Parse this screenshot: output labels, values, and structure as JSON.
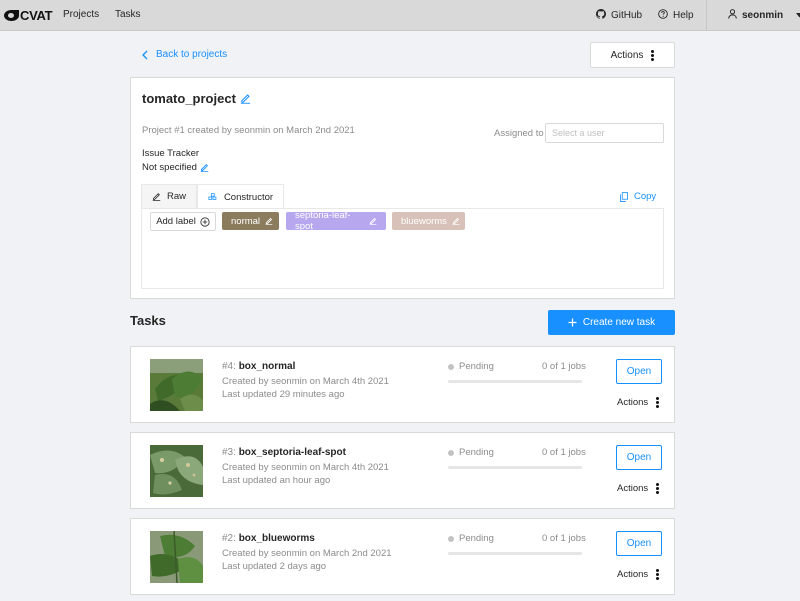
{
  "header": {
    "logo_text": "CVAT",
    "nav": [
      "Projects",
      "Tasks"
    ],
    "github_label": "GitHub",
    "help_label": "Help",
    "username": "seonmin"
  },
  "back_link": "Back to projects",
  "actions_label": "Actions",
  "project": {
    "name": "tomato_project",
    "meta": "Project #1 created by seonmin on March 2nd 2021",
    "assigned_to_label": "Assigned to",
    "assignee_placeholder": "Select a user",
    "issue_tracker_label": "Issue Tracker",
    "issue_tracker_value": "Not specified"
  },
  "label_editor": {
    "tabs": [
      "Raw",
      "Constructor"
    ],
    "active_tab": "Constructor",
    "copy_label": "Copy",
    "add_label": "Add label",
    "labels": [
      {
        "name": "normal",
        "color": "#8c7c5e"
      },
      {
        "name": "septoria-leaf-spot",
        "color": "#b6a7ee"
      },
      {
        "name": "blueworms",
        "color": "#d8c1b9"
      }
    ]
  },
  "tasks_section": {
    "title": "Tasks",
    "create_button": "Create new task"
  },
  "tasks": [
    {
      "id": "#4:",
      "name": "box_normal",
      "created": "Created by seonmin on March 4th 2021",
      "updated": "Last updated 29 minutes ago",
      "status": "Pending",
      "jobs": "0 of 1 jobs",
      "progress": 0,
      "open": "Open",
      "actions": "Actions"
    },
    {
      "id": "#3:",
      "name": "box_septoria-leaf-spot",
      "created": "Created by seonmin on March 4th 2021",
      "updated": "Last updated an hour ago",
      "status": "Pending",
      "jobs": "0 of 1 jobs",
      "progress": 0,
      "open": "Open",
      "actions": "Actions"
    },
    {
      "id": "#2:",
      "name": "box_blueworms",
      "created": "Created by seonmin on March 2nd 2021",
      "updated": "Last updated 2 days ago",
      "status": "Pending",
      "jobs": "0 of 1 jobs",
      "progress": 0,
      "open": "Open",
      "actions": "Actions"
    }
  ]
}
